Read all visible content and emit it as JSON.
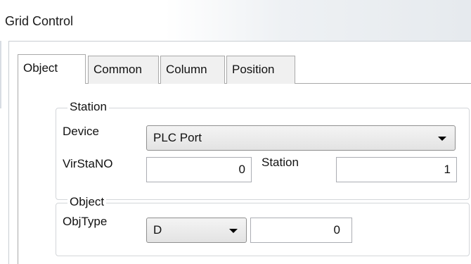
{
  "window": {
    "title": "Grid Control"
  },
  "tabs": [
    {
      "label": "Object",
      "active": true
    },
    {
      "label": "Common",
      "active": false
    },
    {
      "label": "Column",
      "active": false
    },
    {
      "label": "Position",
      "active": false
    }
  ],
  "station_group": {
    "label": "Station",
    "device_label": "Device",
    "device_value": "PLC Port",
    "virstano_label": "VirStaNO",
    "virstano_value": "0",
    "station_label": "Station",
    "station_value": "1"
  },
  "object_group": {
    "label": "Object",
    "objtype_label": "ObjType",
    "objtype_value": "D",
    "address_value": "0"
  }
}
